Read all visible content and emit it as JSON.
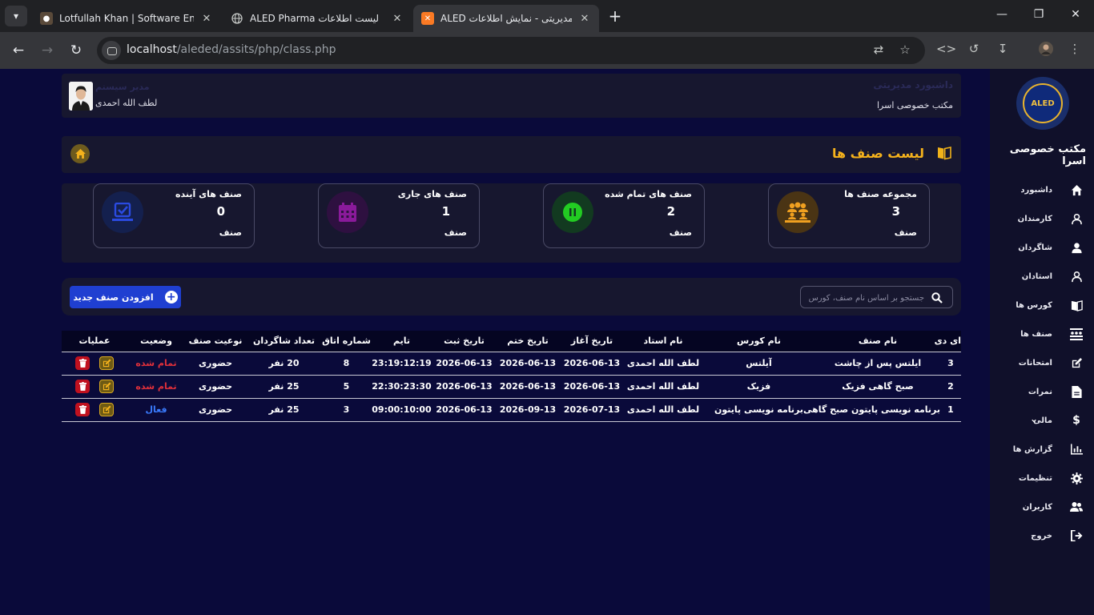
{
  "browser": {
    "tabs": [
      {
        "title": "Lotfullah Khan | Software Engine",
        "active": false
      },
      {
        "title": "ALED Pharma لیست اطلاعات",
        "active": false
      },
      {
        "title": "ALED سیستم مدیریتی - نمایش اطلاعات",
        "active": true
      }
    ],
    "url_host": "localhost",
    "url_path": "/aleded/assits/php/class.php"
  },
  "sidebar": {
    "logo_text": "ALED",
    "school_name": "مکتب خصوصی اسرا",
    "items": [
      {
        "label": "داشبورد",
        "icon": "home-icon"
      },
      {
        "label": "کارمندان",
        "icon": "user-outline-icon"
      },
      {
        "label": "شاگردان",
        "icon": "user-icon"
      },
      {
        "label": "استادان",
        "icon": "user-outline-icon"
      },
      {
        "label": "کورس ها",
        "icon": "book-icon"
      },
      {
        "label": "صنف ها",
        "icon": "classroom-icon"
      },
      {
        "label": "امتحانات",
        "icon": "edit-icon"
      },
      {
        "label": "نمرات",
        "icon": "file-icon"
      },
      {
        "label": "مالی",
        "icon": "dollar-icon"
      },
      {
        "label": "گزارش ها",
        "icon": "chart-icon"
      },
      {
        "label": "تنظیمات",
        "icon": "gear-icon"
      },
      {
        "label": "کاربران",
        "icon": "users-icon"
      },
      {
        "label": "خروج",
        "icon": "logout-icon"
      }
    ]
  },
  "header": {
    "title": "داشبورد مدیریتی",
    "subtitle": "مکتب خصوصی اسرا",
    "user_role": "مدیر سیستم",
    "user_name": "لطف الله احمدی"
  },
  "page_title": "لیست صنف ها",
  "stats": [
    {
      "label": "مجموعه صنف ها",
      "value": "3",
      "unit": "صنف",
      "color": "#f0a020",
      "bg": "#4a3414",
      "icon": "people-icon"
    },
    {
      "label": "صنف های تمام شده",
      "value": "2",
      "unit": "صنف",
      "color": "#22cc22",
      "bg": "#123a20",
      "icon": "pause-icon"
    },
    {
      "label": "صنف های جاری",
      "value": "1",
      "unit": "صنف",
      "color": "#8a1a9a",
      "bg": "#2e1040",
      "icon": "calendar-icon"
    },
    {
      "label": "صنف های آینده",
      "value": "0",
      "unit": "صنف",
      "color": "#2040d0",
      "bg": "#14204e",
      "icon": "checkbox-icon"
    }
  ],
  "search": {
    "placeholder": "جستجو بر اساس نام صنف، کورس"
  },
  "add_button": "افزودن صنف جدید",
  "table": {
    "headers": [
      "ای دی",
      "نام صنف",
      "نام کورس",
      "نام استاد",
      "تاریخ آغاز",
      "تاریخ ختم",
      "تاریخ ثبت",
      "تایم",
      "شماره اتاق",
      "تعداد شاگردان",
      "نوعیت صنف",
      "وضعیت",
      "عملیات"
    ],
    "rows": [
      {
        "id": "3",
        "class_name": "ایلتس پس از چاشت",
        "course": "آیلتس",
        "teacher": "لطف الله احمدی",
        "start": "2026-06-13",
        "end": "2026-06-13",
        "reg": "2026-06-13",
        "time": "23:19:12:19",
        "room": "8",
        "students": "20 نفر",
        "type": "حضوری",
        "status": "تمام شده",
        "status_kind": "done"
      },
      {
        "id": "2",
        "class_name": "صبح گاهی فزیک",
        "course": "فزیک",
        "teacher": "لطف الله احمدی",
        "start": "2026-06-13",
        "end": "2026-06-13",
        "reg": "2026-06-13",
        "time": "22:30:23:30",
        "room": "5",
        "students": "25 نفر",
        "type": "حضوری",
        "status": "تمام شده",
        "status_kind": "done"
      },
      {
        "id": "1",
        "class_name": "برنامه نویسی پایتون صبح گاهی",
        "course": "برنامه نویسی پایتون",
        "teacher": "لطف الله احمدی",
        "start": "2026-07-13",
        "end": "2026-09-13",
        "reg": "2026-06-13",
        "time": "09:00:10:00",
        "room": "3",
        "students": "25 نفر",
        "type": "حضوری",
        "status": "فعال",
        "status_kind": "active"
      }
    ]
  }
}
